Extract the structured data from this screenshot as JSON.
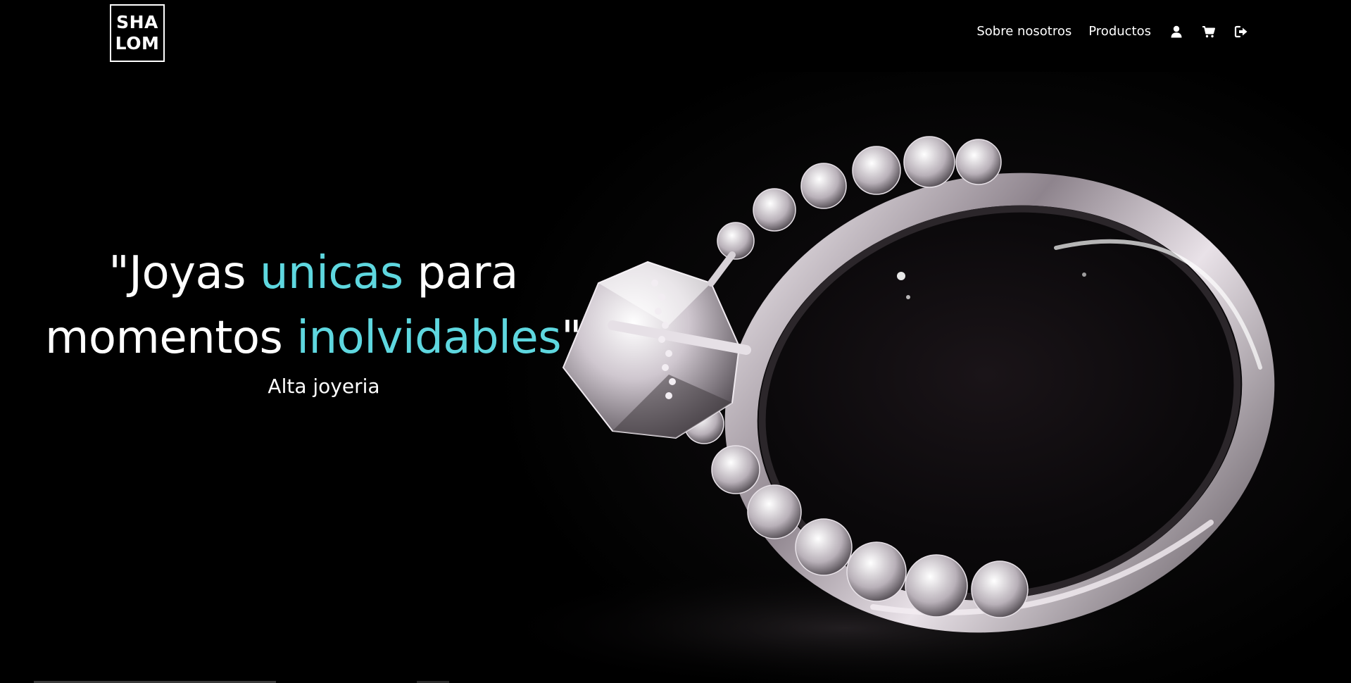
{
  "brand": {
    "logo_line1": "SHA",
    "logo_line2": "LOM"
  },
  "nav": {
    "links": [
      "Sobre nosotros",
      "Productos"
    ],
    "icons": [
      "user-icon",
      "cart-icon",
      "logout-icon"
    ]
  },
  "hero": {
    "headline_part1": "\"Joyas ",
    "headline_accent1": "unicas",
    "headline_part2": " para",
    "headline_part3": "momentos ",
    "headline_accent2": "inolvidables",
    "headline_part4": "\"",
    "subtitle": "Alta joyeria",
    "accent_color": "#5ed7df",
    "background_image": "diamond-ring-photo"
  }
}
